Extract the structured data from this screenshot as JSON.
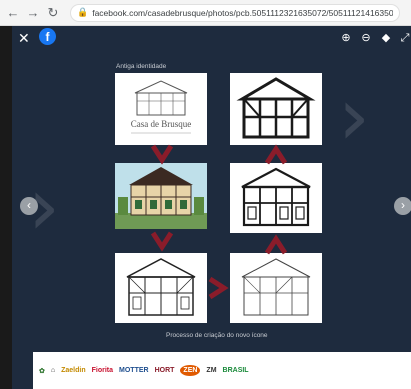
{
  "browser": {
    "url": "facebook.com/casadebrusque/photos/pcb.5051112321635072/5051112141635090"
  },
  "viewer": {
    "caption_top": "Antiga identidade",
    "caption_bottom": "Processo de criação do novo ícone",
    "logo_text": "Casa de Brusque"
  },
  "sponsors": [
    "Zaeldin",
    "Fiorita",
    "MOTTER",
    "HORT",
    "ZEN",
    "ZM",
    "BRASIL"
  ],
  "colors": {
    "viewer_bg": "#1e2b3e",
    "arrow_red": "#8a1c2a",
    "facebook_blue": "#1877f2"
  }
}
